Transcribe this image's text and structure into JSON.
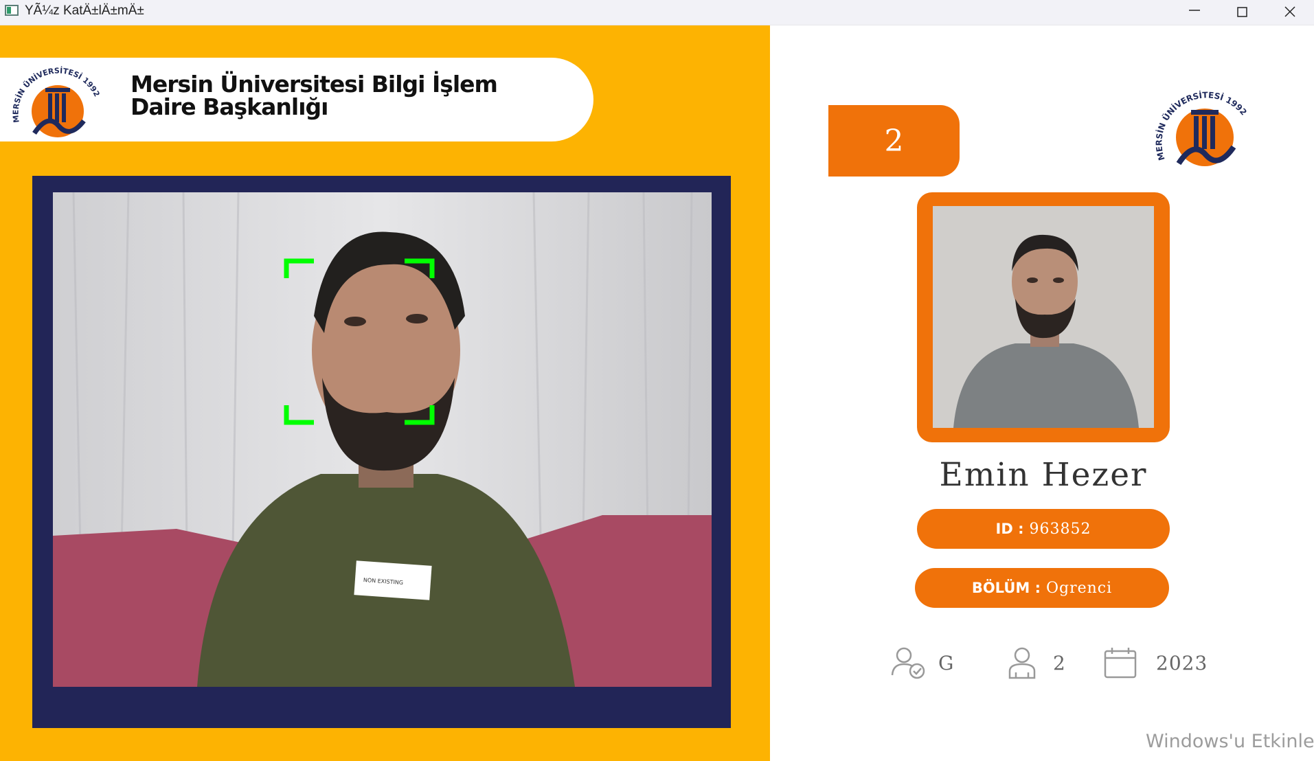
{
  "window": {
    "title": "YÃ¼z KatÄ±lÄ±mÄ±",
    "icon": "app-window-icon",
    "controls": [
      "minimize-icon",
      "maximize-icon",
      "close-icon"
    ]
  },
  "header": {
    "logo": "mersin-university-logo",
    "logo_text": "MERSİN ÜNİVERSİTESİ 1992",
    "title_line1": "Mersin Üniversitesi Bilgi İşlem",
    "title_line2": "Daire Başkanlığı"
  },
  "camera": {
    "feed": "live-camera-feed",
    "detection": "face-detection-box",
    "shirt_tag": "NON EXISTING"
  },
  "panel": {
    "counter": "2",
    "logo_text": "MERSİN ÜNİVERSİTESİ 1992",
    "name": "Emin  Hezer",
    "id_label": "ID :",
    "id_value": "963852",
    "bolum_label": "BÖLÜM :",
    "bolum_value": "Ogrenci",
    "stats": [
      {
        "icon": "user-check-icon",
        "value": "G"
      },
      {
        "icon": "user-icon",
        "value": "2"
      },
      {
        "icon": "calendar-icon",
        "value": "2023"
      }
    ]
  },
  "watermark": "Windows'u Etkinleştir",
  "colors": {
    "left_background": "#fdb302",
    "accent_orange": "#f0720a",
    "camera_border": "#222557",
    "detection_green": "#00ff00"
  }
}
